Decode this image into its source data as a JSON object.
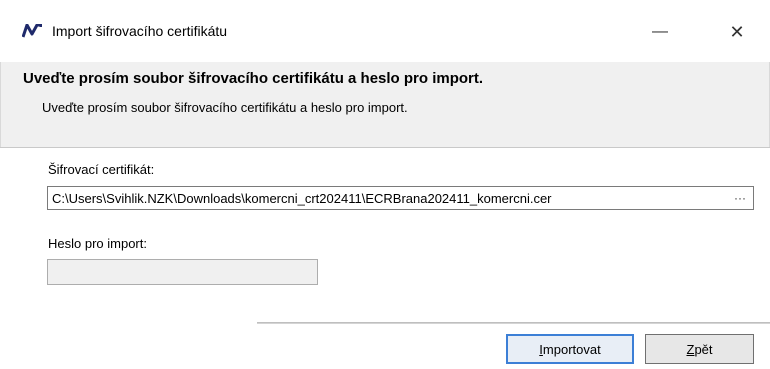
{
  "window": {
    "title": "Import šifrovacího certifikátu",
    "minimize_glyph": "—",
    "close_glyph": "✕"
  },
  "header": {
    "title": "Uveďte prosím soubor šifrovacího certifikátu a heslo pro import.",
    "description": "Uveďte prosím soubor šifrovacího certifikátu a heslo pro import."
  },
  "form": {
    "certificate_label": "Šifrovací certifikát:",
    "certificate_path": "C:\\Users\\Svihlik.NZK\\Downloads\\komercni_crt202411\\ECRBrana202411_komercni.cer",
    "browse_glyph": "···",
    "password_label": "Heslo pro import:",
    "password_value": ""
  },
  "buttons": {
    "import_mnemonic": "I",
    "import_rest": "mportovat",
    "back_mnemonic": "Z",
    "back_rest": "pět"
  },
  "colors": {
    "accent": "#3c7fd6",
    "header_bg": "#f0f0f0",
    "logo": "#1f2a6b"
  },
  "icons": {
    "app": "app-logo-icon",
    "minimize": "minimize-icon",
    "close": "close-icon",
    "browse": "ellipsis-icon"
  }
}
